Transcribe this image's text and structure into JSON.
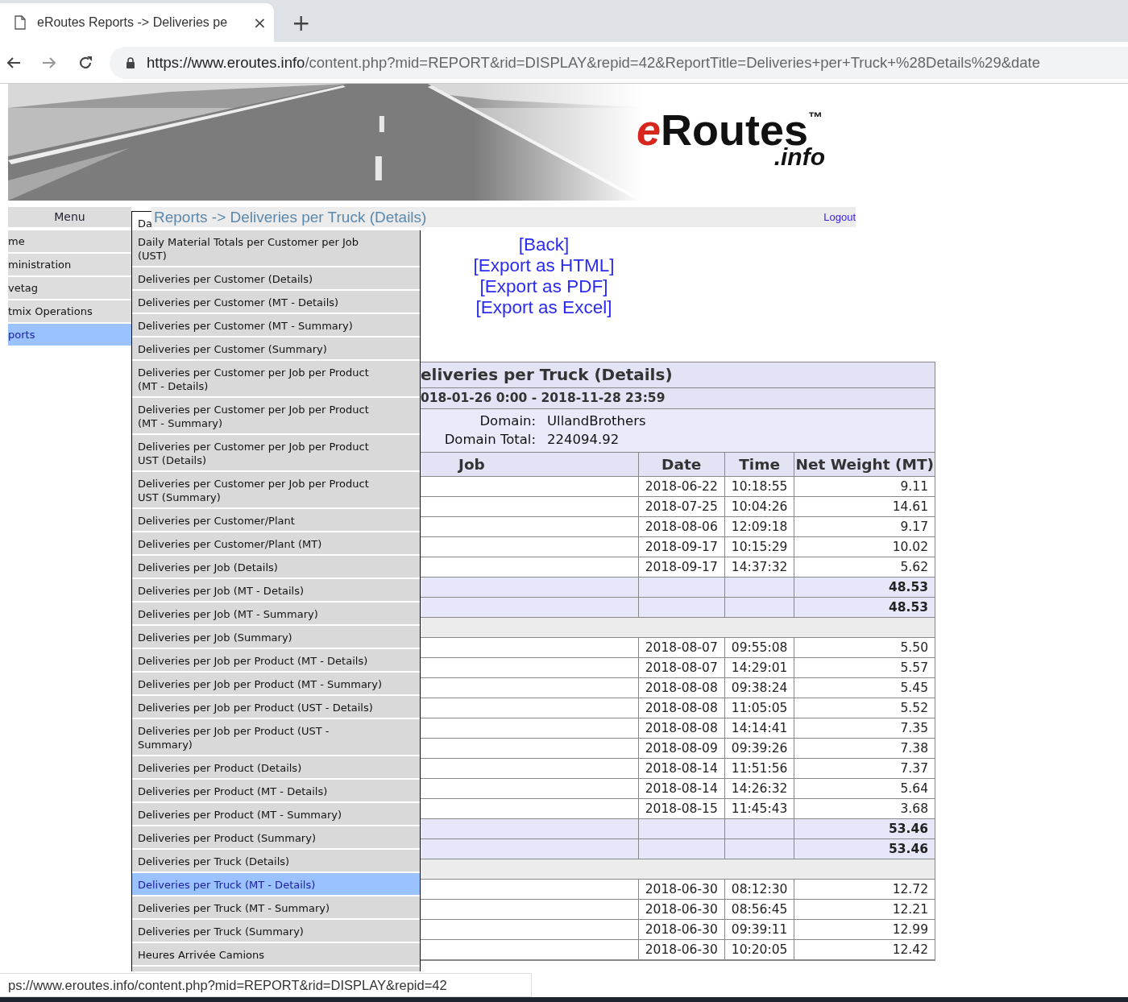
{
  "browser": {
    "tab_title": "eRoutes Reports -> Deliveries pe",
    "close": "×",
    "new_tab": "+",
    "url_origin": "https://www.eroutes.info",
    "url_rest": "/content.php?mid=REPORT&rid=DISPLAY&repid=42&ReportTitle=Deliveries+per+Truck+%28Details%29&date"
  },
  "banner": {
    "kind": "picture",
    "logo_mark": "e",
    "logo_name": "Routes",
    "logo_tm": "™",
    "logo_suffix": ".info"
  },
  "menu": {
    "title": "Menu",
    "items": [
      {
        "label": "me",
        "selected": false
      },
      {
        "label": "ministration",
        "selected": false
      },
      {
        "label": "vetag",
        "selected": false
      },
      {
        "label": "tmix Operations",
        "selected": false
      },
      {
        "label": "ports",
        "selected": true
      }
    ]
  },
  "breadcrumb": "Reports -> Deliveries per Truck (Details)",
  "logout": "Logout",
  "dropdown": [
    {
      "label": "Da",
      "selected": false
    },
    {
      "label": "Daily Material Totals per Customer per Job\n(UST)",
      "selected": false
    },
    {
      "label": "Deliveries per Customer (Details)",
      "selected": false
    },
    {
      "label": "Deliveries per Customer (MT - Details)",
      "selected": false
    },
    {
      "label": "Deliveries per Customer (MT - Summary)",
      "selected": false
    },
    {
      "label": "Deliveries per Customer (Summary)",
      "selected": false
    },
    {
      "label": "Deliveries per Customer per Job per Product\n(MT - Details)",
      "selected": false
    },
    {
      "label": "Deliveries per Customer per Job per Product\n(MT - Summary)",
      "selected": false
    },
    {
      "label": "Deliveries per Customer per Job per Product\nUST (Details)",
      "selected": false
    },
    {
      "label": "Deliveries per Customer per Job per Product\nUST (Summary)",
      "selected": false
    },
    {
      "label": "Deliveries per Customer/Plant",
      "selected": false
    },
    {
      "label": "Deliveries per Customer/Plant (MT)",
      "selected": false
    },
    {
      "label": "Deliveries per Job (Details)",
      "selected": false
    },
    {
      "label": "Deliveries per Job (MT - Details)",
      "selected": false
    },
    {
      "label": "Deliveries per Job (MT - Summary)",
      "selected": false
    },
    {
      "label": "Deliveries per Job (Summary)",
      "selected": false
    },
    {
      "label": "Deliveries per Job per Product (MT - Details)",
      "selected": false
    },
    {
      "label": "Deliveries per Job per Product (MT - Summary)",
      "selected": false
    },
    {
      "label": "Deliveries per Job per Product (UST - Details)",
      "selected": false
    },
    {
      "label": "Deliveries per Job per Product (UST -\nSummary)",
      "selected": false
    },
    {
      "label": "Deliveries per Product (Details)",
      "selected": false
    },
    {
      "label": "Deliveries per Product (MT - Details)",
      "selected": false
    },
    {
      "label": "Deliveries per Product (MT - Summary)",
      "selected": false
    },
    {
      "label": "Deliveries per Product (Summary)",
      "selected": false
    },
    {
      "label": "Deliveries per Truck (Details)",
      "selected": false
    },
    {
      "label": "Deliveries per Truck (MT - Details)",
      "selected": true
    },
    {
      "label": "Deliveries per Truck (MT - Summary)",
      "selected": false
    },
    {
      "label": "Deliveries per Truck (Summary)",
      "selected": false
    },
    {
      "label": "Heures Arrivée Camions",
      "selected": false
    }
  ],
  "links": [
    "[Back]",
    "[Export as HTML]",
    "[Export as PDF]",
    "[Export as Excel]"
  ],
  "report": {
    "title": "eliveries per Truck (Details)",
    "period": "018-01-26 0:00 - 2018-11-28 23:59",
    "info": [
      {
        "label": "Domain:",
        "value": "UllandBrothers"
      },
      {
        "label": "Domain Total:",
        "value": "224094.92"
      }
    ],
    "columns": [
      "Job",
      "Date",
      "Time",
      "Net Weight (MT)"
    ],
    "rows": [
      {
        "kind": "data",
        "date": "2018-06-22",
        "time": "10:18:55",
        "weight": "9.11"
      },
      {
        "kind": "data",
        "date": "2018-07-25",
        "time": "10:04:26",
        "weight": "14.61"
      },
      {
        "kind": "data",
        "date": "2018-08-06",
        "time": "12:09:18",
        "weight": "9.17"
      },
      {
        "kind": "data",
        "date": "2018-09-17",
        "time": "10:15:29",
        "weight": "10.02"
      },
      {
        "kind": "data",
        "date": "2018-09-17",
        "time": "14:37:32",
        "weight": "5.62"
      },
      {
        "kind": "total",
        "weight": "48.53"
      },
      {
        "kind": "total",
        "weight": "48.53"
      },
      {
        "kind": "separator"
      },
      {
        "kind": "data",
        "date": "2018-08-07",
        "time": "09:55:08",
        "weight": "5.50"
      },
      {
        "kind": "data",
        "date": "2018-08-07",
        "time": "14:29:01",
        "weight": "5.57"
      },
      {
        "kind": "data",
        "date": "2018-08-08",
        "time": "09:38:24",
        "weight": "5.45"
      },
      {
        "kind": "data",
        "date": "2018-08-08",
        "time": "11:05:05",
        "weight": "5.52"
      },
      {
        "kind": "data",
        "date": "2018-08-08",
        "time": "14:14:41",
        "weight": "7.35"
      },
      {
        "kind": "data",
        "date": "2018-08-09",
        "time": "09:39:26",
        "weight": "7.38"
      },
      {
        "kind": "data",
        "date": "2018-08-14",
        "time": "11:51:56",
        "weight": "7.37"
      },
      {
        "kind": "data",
        "date": "2018-08-14",
        "time": "14:26:32",
        "weight": "5.64"
      },
      {
        "kind": "data",
        "date": "2018-08-15",
        "time": "11:45:43",
        "weight": "3.68"
      },
      {
        "kind": "total",
        "weight": "53.46"
      },
      {
        "kind": "total",
        "weight": "53.46"
      },
      {
        "kind": "separator"
      },
      {
        "kind": "data",
        "date": "2018-06-30",
        "time": "08:12:30",
        "weight": "12.72"
      },
      {
        "kind": "data",
        "date": "2018-06-30",
        "time": "08:56:45",
        "weight": "12.21"
      },
      {
        "kind": "data",
        "date": "2018-06-30",
        "time": "09:39:11",
        "weight": "12.99"
      },
      {
        "kind": "data",
        "date": "2018-06-30",
        "time": "10:20:05",
        "weight": "12.42"
      }
    ]
  },
  "status_url": "ps://www.eroutes.info/content.php?mid=REPORT&rid=DISPLAY&repid=42"
}
